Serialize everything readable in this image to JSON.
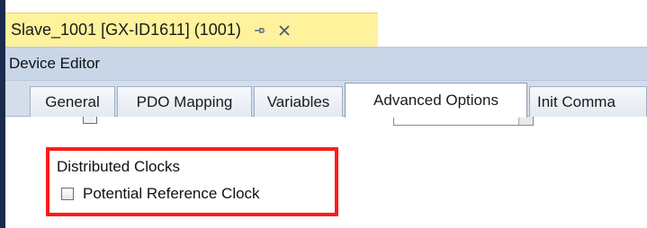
{
  "document_tab": {
    "title": "Slave_1001 [GX-ID1611] (1001)",
    "pin_icon": "pin-icon",
    "close_icon": "close-icon"
  },
  "editor": {
    "title": "Device Editor"
  },
  "tabs": [
    {
      "label": "General"
    },
    {
      "label": "PDO Mapping"
    },
    {
      "label": "Variables"
    },
    {
      "label": "Advanced Options",
      "active": true
    },
    {
      "label": "Init Comma"
    }
  ],
  "distributed_clocks": {
    "group_label": "Distributed Clocks",
    "potential_reference_clock_label": "Potential Reference Clock",
    "potential_reference_clock_checked": false
  },
  "colors": {
    "document_tab": "#fff29d",
    "editor_bar": "#c9d6e8",
    "highlight": "#ff1a1a",
    "left_border": "#1b2b4d"
  }
}
